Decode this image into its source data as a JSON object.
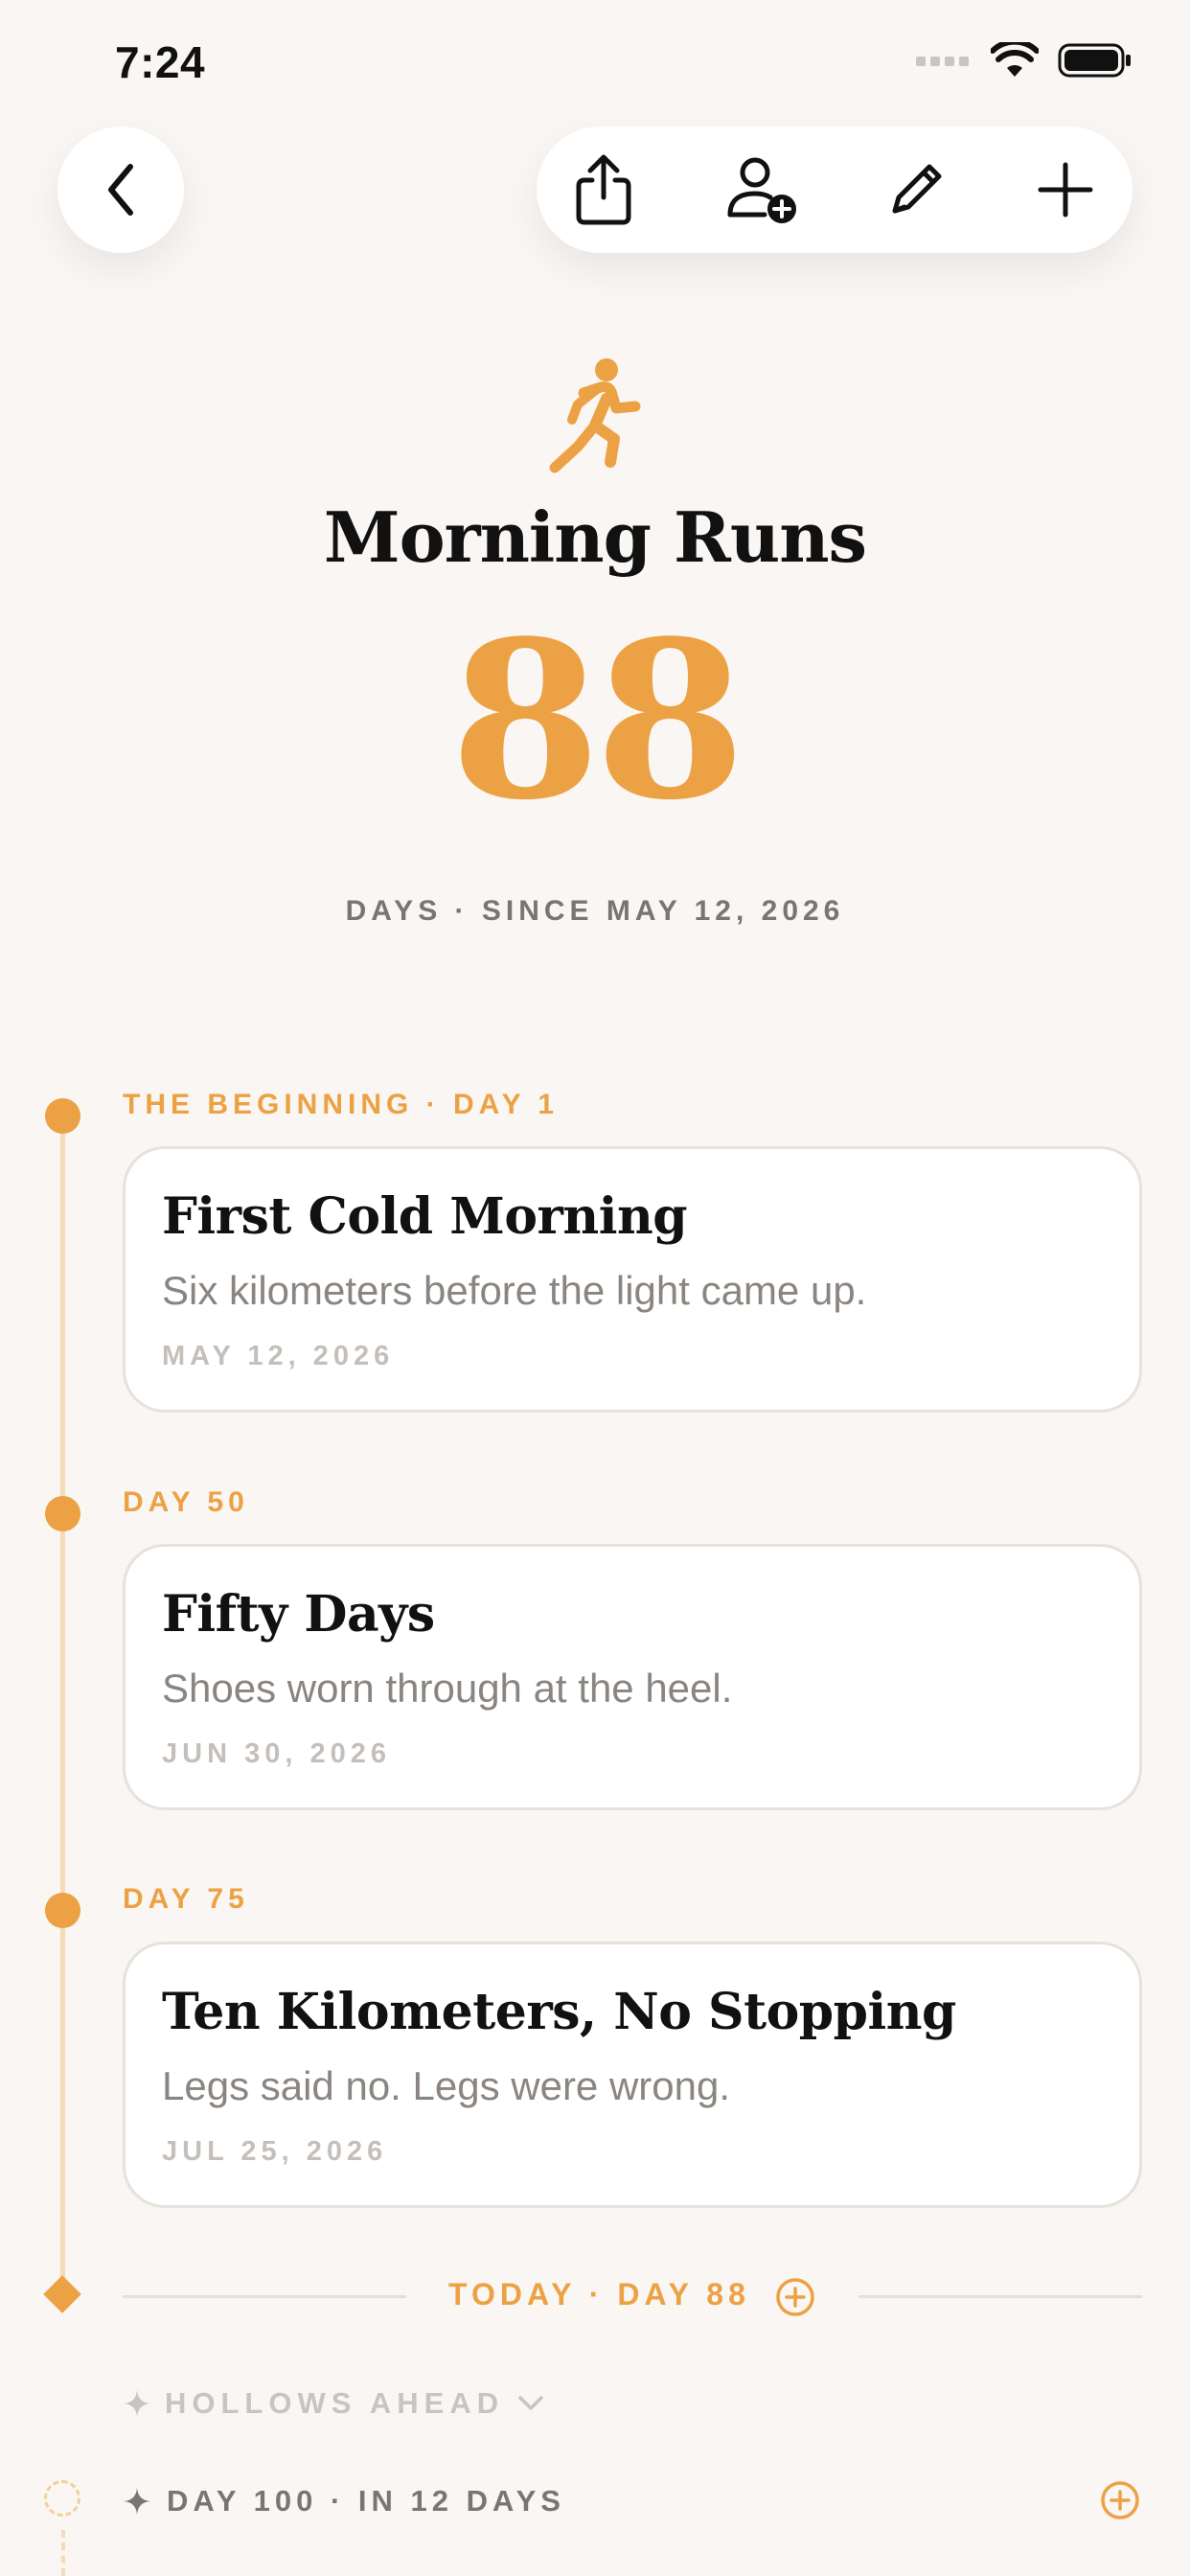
{
  "status_bar": {
    "time": "7:24"
  },
  "colors": {
    "accent": "#eca244",
    "background": "#f9f6f3",
    "card": "#ffffff",
    "rail": "#f5dbb7"
  },
  "toolbar": {
    "icons": [
      "back-chevron-icon",
      "share-icon",
      "add-person-icon",
      "pencil-icon",
      "plus-icon"
    ]
  },
  "header": {
    "icon": "runner-icon",
    "title": "Morning Runs",
    "count": "88",
    "subtitle": "DAYS · SINCE MAY 12, 2026"
  },
  "milestones": [
    {
      "label": "THE BEGINNING · DAY 1",
      "title": "First Cold Morning",
      "description": "Six kilometers before the light came up.",
      "date": "MAY 12, 2026"
    },
    {
      "label": "DAY 50",
      "title": "Fifty Days",
      "description": "Shoes worn through at the heel.",
      "date": "JUN 30, 2026"
    },
    {
      "label": "DAY 75",
      "title": "Ten Kilometers, No Stopping",
      "description": "Legs said no. Legs were wrong.",
      "date": "JUL 25, 2026"
    }
  ],
  "today": {
    "label": "TODAY · DAY 88"
  },
  "hollows": {
    "label": "HOLLOWS AHEAD"
  },
  "upcoming": [
    {
      "label": "DAY 100 · IN 12 DAYS"
    }
  ]
}
